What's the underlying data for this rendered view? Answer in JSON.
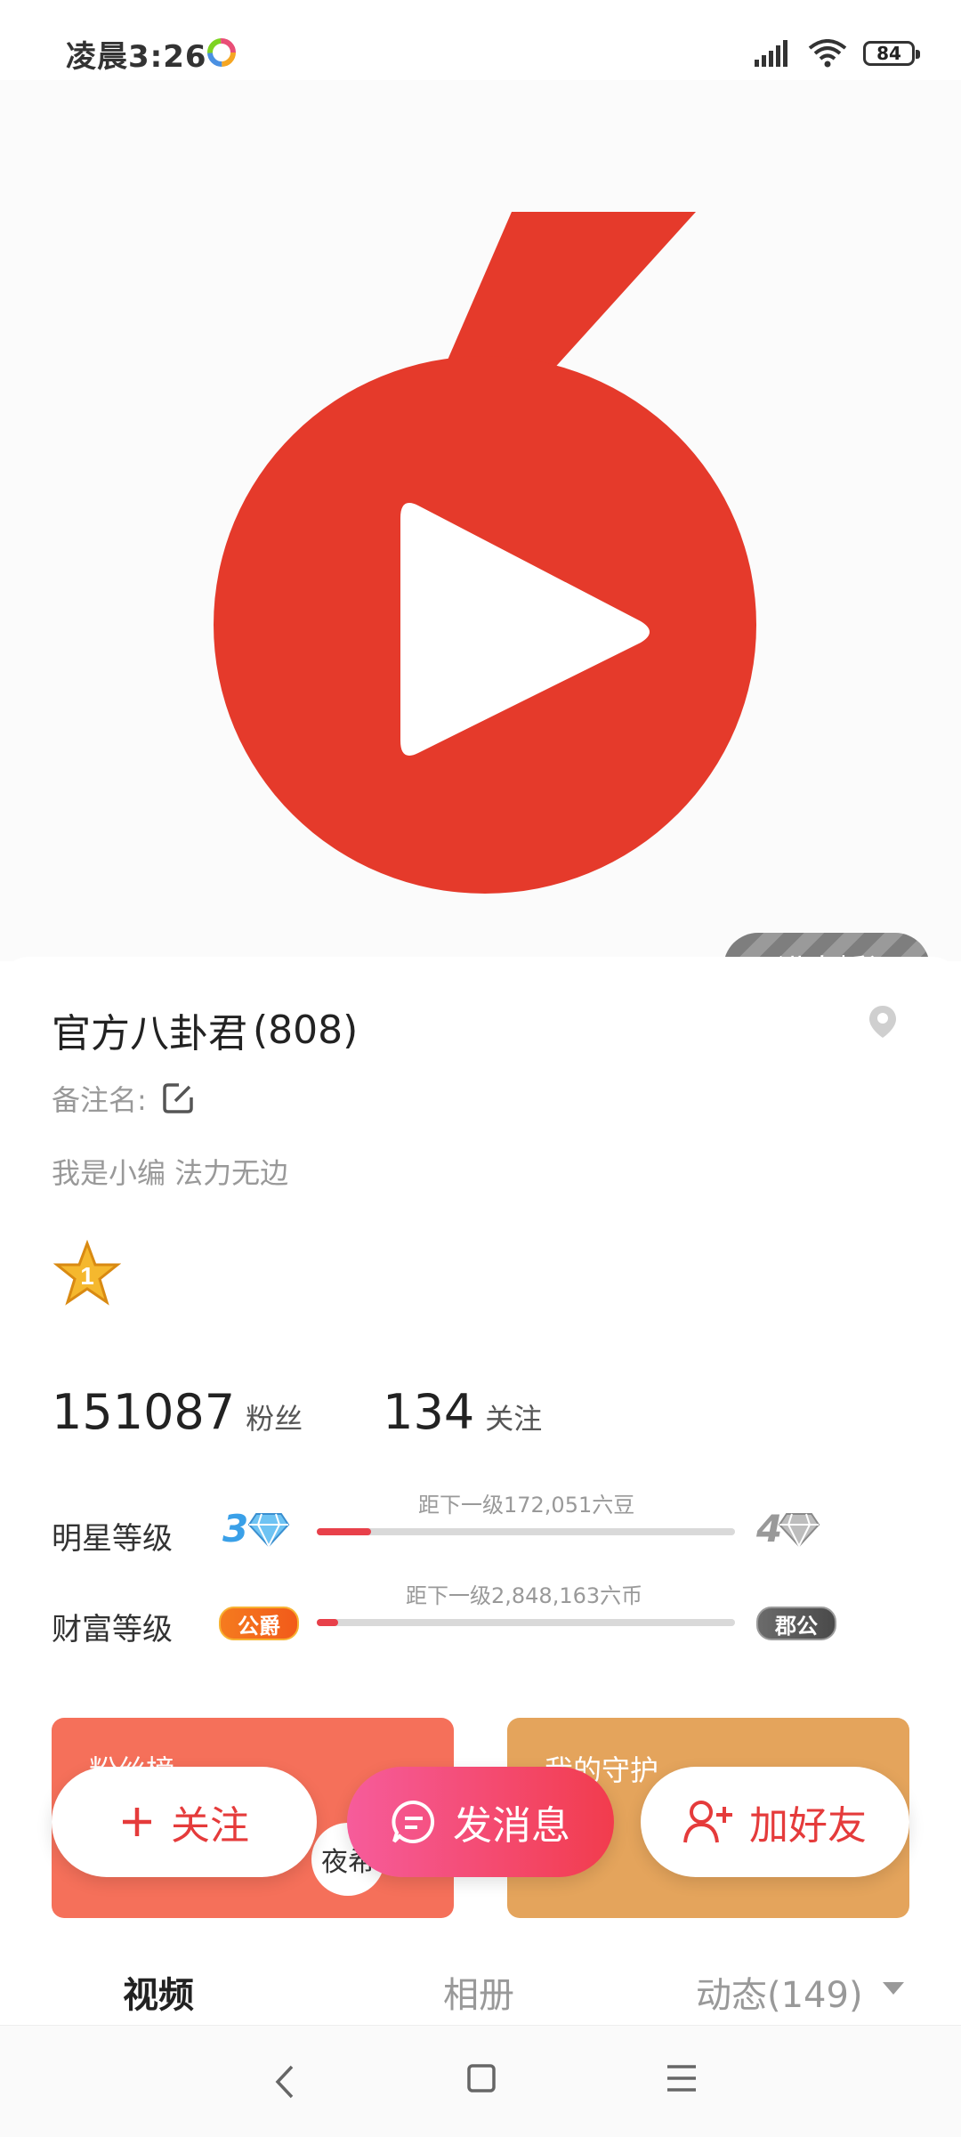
{
  "status_bar": {
    "time": "凌晨3:26",
    "battery": "84"
  },
  "cover": {
    "live_button_label": "进直播间"
  },
  "profile": {
    "name": "官方八卦君",
    "id": "(808)",
    "remark_label": "备注名:",
    "bio": "我是小编 法力无边",
    "star_level": "1"
  },
  "stats": {
    "fans_count": "151087",
    "fans_label": "粉丝",
    "following_count": "134",
    "following_label": "关注"
  },
  "levels": {
    "star": {
      "label": "明星等级",
      "current": "3",
      "next": "4",
      "hint": "距下一级172,051六豆",
      "progress": 0.13
    },
    "wealth": {
      "label": "财富等级",
      "current_badge": "公爵",
      "next_badge": "郡公",
      "hint": "距下一级2,848,163六币",
      "progress": 0.05
    }
  },
  "cards": {
    "left_title": "粉丝榜",
    "right_title": "我的守护",
    "left_avatar_text": "夜希"
  },
  "actions": {
    "follow": "关注",
    "message": "发消息",
    "add_friend": "加好友"
  },
  "tabs": [
    {
      "label": "视频"
    },
    {
      "label": "相册"
    },
    {
      "label": "动态(149)"
    }
  ],
  "colors": {
    "accent": "#e53b3b",
    "logo_red": "#e53a2b",
    "message_gradient_start": "#f65c9b",
    "message_gradient_end": "#f23c4d"
  },
  "icons": [
    "app-icon",
    "signal-icon",
    "wifi-icon",
    "battery-icon",
    "location-pin-icon",
    "edit-icon",
    "star-badge-icon",
    "diamond-icon",
    "plus-icon",
    "chat-icon",
    "add-user-icon",
    "dropdown-arrow-icon",
    "back-icon",
    "home-icon",
    "menu-icon"
  ]
}
